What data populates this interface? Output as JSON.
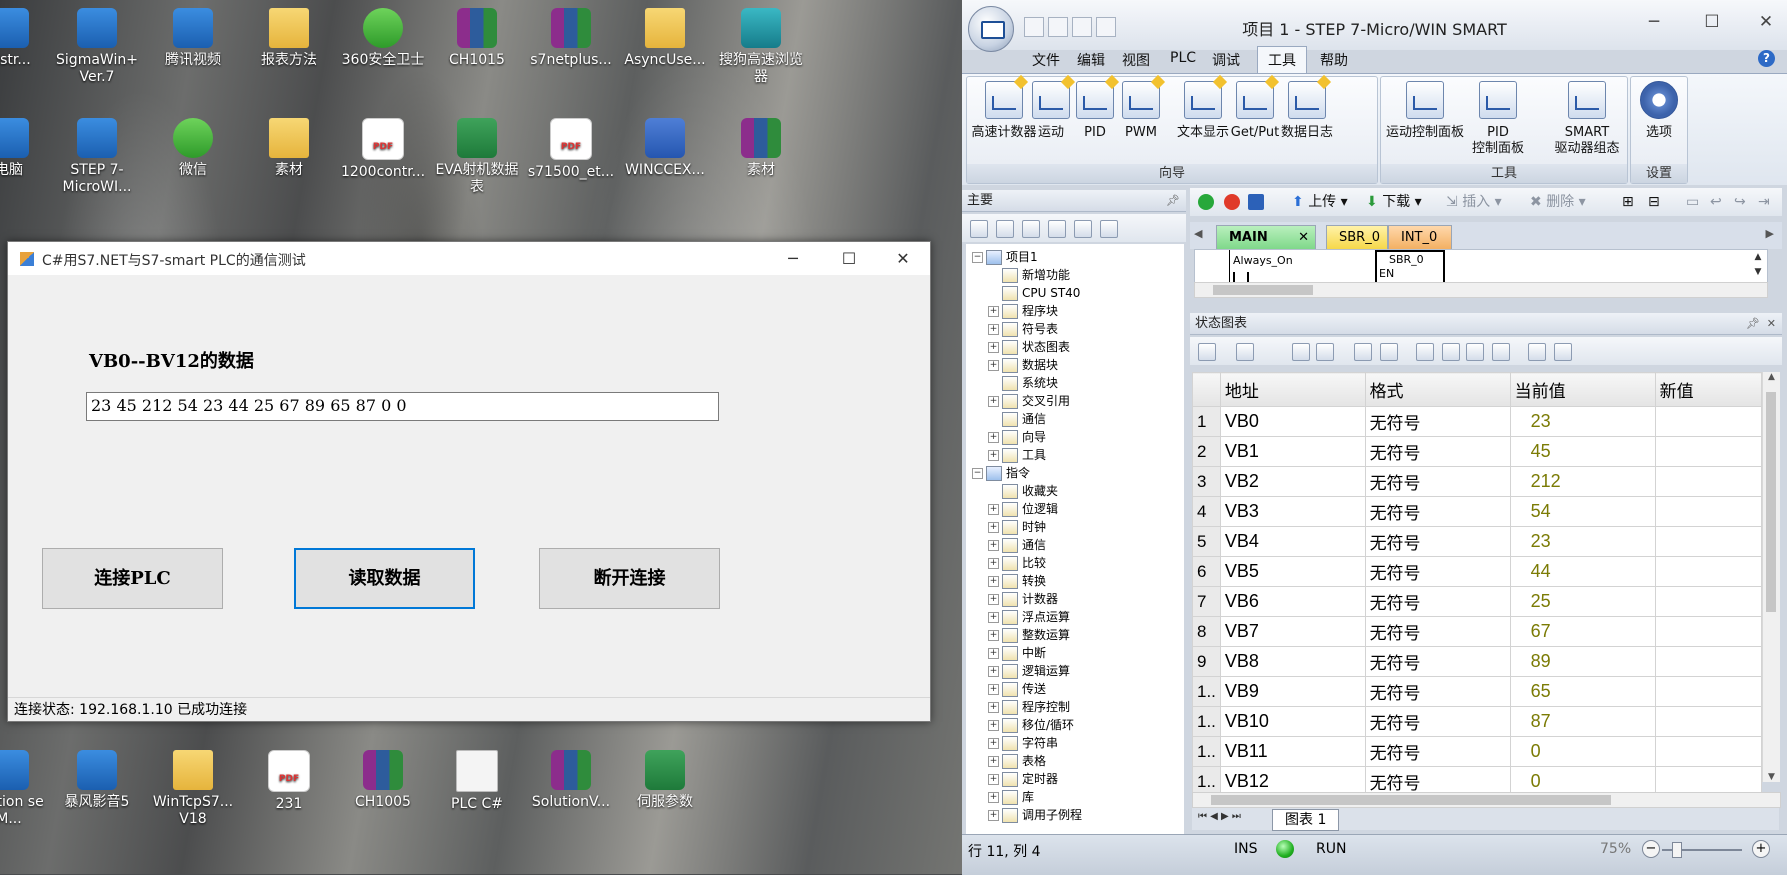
{
  "desktop": {
    "icons": [
      {
        "label": "nistr...",
        "icon": "app-icon"
      },
      {
        "label": "SigmaWin+ Ver.7",
        "icon": "app-icon"
      },
      {
        "label": "腾讯视频",
        "icon": "video-icon"
      },
      {
        "label": "报表方法",
        "icon": "folder-icon"
      },
      {
        "label": "360安全卫士",
        "icon": "shield-icon"
      },
      {
        "label": "CH1015",
        "icon": "archive-icon"
      },
      {
        "label": "s7netplus...",
        "icon": "archive-icon"
      },
      {
        "label": "AsyncUse...",
        "icon": "folder-icon"
      },
      {
        "label": "搜狗高速浏览器",
        "icon": "browser-icon"
      },
      {
        "label": "电脑",
        "icon": "computer-icon"
      },
      {
        "label": "STEP 7-MicroWI...",
        "icon": "app-icon"
      },
      {
        "label": "微信",
        "icon": "chat-icon"
      },
      {
        "label": "素材",
        "icon": "folder-icon"
      },
      {
        "label": "1200contr...",
        "icon": "pdf-icon"
      },
      {
        "label": "EVA射机数据表",
        "icon": "excel-icon"
      },
      {
        "label": "s71500_et...",
        "icon": "pdf-icon"
      },
      {
        "label": "WINCCEX...",
        "icon": "word-icon"
      },
      {
        "label": "素材",
        "icon": "archive-icon"
      },
      {
        "label": "暴风影音5",
        "icon": "app-icon"
      },
      {
        "label": "WinTcpS7... V18",
        "icon": "folder-icon"
      },
      {
        "label": "231",
        "icon": "pdf-icon"
      },
      {
        "label": "CH1005",
        "icon": "archive-icon"
      },
      {
        "label": "PLC C#",
        "icon": "document-icon"
      },
      {
        "label": "SolutionV...",
        "icon": "archive-icon"
      },
      {
        "label": "伺服参数",
        "icon": "excel-icon"
      },
      {
        "label": "mation se M...",
        "icon": "app-icon"
      }
    ]
  },
  "csform": {
    "title": "C#用S7.NET与S7-smart PLC的通信测试",
    "label": "VB0--BV12的数据",
    "data_value": "23 45 212 54 23 44 25 67 89 65 87 0 0",
    "buttons": {
      "connect": "连接PLC",
      "read": "读取数据",
      "disconnect": "断开连接"
    },
    "status": "连接状态:  192.168.1.10 已成功连接"
  },
  "step7": {
    "title": "项目 1 - STEP 7-Micro/WIN SMART",
    "menus": [
      "文件",
      "编辑",
      "视图",
      "PLC",
      "调试",
      "工具",
      "帮助"
    ],
    "active_menu": "工具",
    "ribbon": {
      "wizard_items": [
        "高速计数器",
        "运动",
        "PID",
        "PWM",
        "文本显示",
        "Get/Put",
        "数据日志"
      ],
      "wizard_caption": "向导",
      "tool_items": [
        "运动控制面板",
        "PID\n控制面板",
        "SMART\n驱动器组态"
      ],
      "tool_caption": "工具",
      "setting_items": [
        "选项"
      ],
      "setting_caption": "设置"
    },
    "main_panel": {
      "title": "主要",
      "tree": [
        {
          "label": "项目1",
          "level": 0,
          "exp": "−"
        },
        {
          "label": "新增功能",
          "level": 1,
          "exp": ""
        },
        {
          "label": "CPU ST40",
          "level": 1,
          "exp": ""
        },
        {
          "label": "程序块",
          "level": 1,
          "exp": "+"
        },
        {
          "label": "符号表",
          "level": 1,
          "exp": "+"
        },
        {
          "label": "状态图表",
          "level": 1,
          "exp": "+"
        },
        {
          "label": "数据块",
          "level": 1,
          "exp": "+"
        },
        {
          "label": "系统块",
          "level": 1,
          "exp": ""
        },
        {
          "label": "交叉引用",
          "level": 1,
          "exp": "+"
        },
        {
          "label": "通信",
          "level": 1,
          "exp": ""
        },
        {
          "label": "向导",
          "level": 1,
          "exp": "+"
        },
        {
          "label": "工具",
          "level": 1,
          "exp": "+"
        },
        {
          "label": "指令",
          "level": 0,
          "exp": "−"
        },
        {
          "label": "收藏夹",
          "level": 1,
          "exp": ""
        },
        {
          "label": "位逻辑",
          "level": 1,
          "exp": "+"
        },
        {
          "label": "时钟",
          "level": 1,
          "exp": "+"
        },
        {
          "label": "通信",
          "level": 1,
          "exp": "+"
        },
        {
          "label": "比较",
          "level": 1,
          "exp": "+"
        },
        {
          "label": "转换",
          "level": 1,
          "exp": "+"
        },
        {
          "label": "计数器",
          "level": 1,
          "exp": "+"
        },
        {
          "label": "浮点运算",
          "level": 1,
          "exp": "+"
        },
        {
          "label": "整数运算",
          "level": 1,
          "exp": "+"
        },
        {
          "label": "中断",
          "level": 1,
          "exp": "+"
        },
        {
          "label": "逻辑运算",
          "level": 1,
          "exp": "+"
        },
        {
          "label": "传送",
          "level": 1,
          "exp": "+"
        },
        {
          "label": "程序控制",
          "level": 1,
          "exp": "+"
        },
        {
          "label": "移位/循环",
          "level": 1,
          "exp": "+"
        },
        {
          "label": "字符串",
          "level": 1,
          "exp": "+"
        },
        {
          "label": "表格",
          "level": 1,
          "exp": "+"
        },
        {
          "label": "定时器",
          "level": 1,
          "exp": "+"
        },
        {
          "label": "库",
          "level": 1,
          "exp": "+"
        },
        {
          "label": "调用子例程",
          "level": 1,
          "exp": "+"
        }
      ]
    },
    "editor": {
      "upload": "上传",
      "download": "下载",
      "insert": "插入",
      "delete": "删除",
      "tabs": [
        "MAIN",
        "SBR_0",
        "INT_0"
      ],
      "ladder_always_on": "Always_On",
      "ladder_sbr": "SBR_0",
      "ladder_en": "EN"
    },
    "status_chart": {
      "title": "状态图表",
      "headers": [
        "地址",
        "格式",
        "当前值",
        "新值"
      ],
      "rows": [
        {
          "n": "1",
          "addr": "VB0",
          "fmt": "无符号",
          "cur": "23",
          "new": ""
        },
        {
          "n": "2",
          "addr": "VB1",
          "fmt": "无符号",
          "cur": "45",
          "new": ""
        },
        {
          "n": "3",
          "addr": "VB2",
          "fmt": "无符号",
          "cur": "212",
          "new": ""
        },
        {
          "n": "4",
          "addr": "VB3",
          "fmt": "无符号",
          "cur": "54",
          "new": ""
        },
        {
          "n": "5",
          "addr": "VB4",
          "fmt": "无符号",
          "cur": "23",
          "new": ""
        },
        {
          "n": "6",
          "addr": "VB5",
          "fmt": "无符号",
          "cur": "44",
          "new": ""
        },
        {
          "n": "7",
          "addr": "VB6",
          "fmt": "无符号",
          "cur": "25",
          "new": ""
        },
        {
          "n": "8",
          "addr": "VB7",
          "fmt": "无符号",
          "cur": "67",
          "new": ""
        },
        {
          "n": "9",
          "addr": "VB8",
          "fmt": "无符号",
          "cur": "89",
          "new": ""
        },
        {
          "n": "1..",
          "addr": "VB9",
          "fmt": "无符号",
          "cur": "65",
          "new": ""
        },
        {
          "n": "1..",
          "addr": "VB10",
          "fmt": "无符号",
          "cur": "87",
          "new": ""
        },
        {
          "n": "1..",
          "addr": "VB11",
          "fmt": "无符号",
          "cur": "0",
          "new": ""
        },
        {
          "n": "1..",
          "addr": "VB12",
          "fmt": "无符号",
          "cur": "0",
          "new": ""
        }
      ],
      "sheet_tab": "图表 1"
    },
    "statusbar": {
      "position": "行 11, 列 4",
      "ins": "INS",
      "run": "RUN",
      "zoom": "75%"
    }
  }
}
